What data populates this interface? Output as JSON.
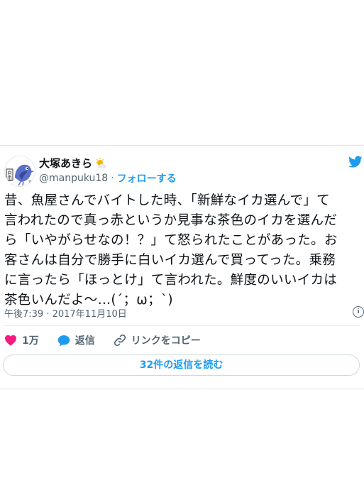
{
  "author": {
    "name": "大塚あきら",
    "name_emoji_icon": "sun-behind-cloud-icon",
    "handle": "@manpuku18",
    "separator": "·",
    "follow_label": "フォローする",
    "avatar_icon": "bird-stamp-avatar"
  },
  "platform_icon": "twitter-bird-icon",
  "tweet": {
    "lines": [
      "昔、魚屋さんでバイトした時、「新鮮なイカ選んで」て",
      "言われたので真っ赤というか見事な茶色のイカを選んだ",
      "ら「いやがらせなの！？」て怒られたことがあった。お",
      "客さんは自分で勝手に白いイカ選んで買ってった。乗務",
      "に言ったら「ほっとけ」て言われた。鮮度のいいイカは",
      "茶色いんだよ〜…(´；ω；`)"
    ],
    "timestamp": "午後7:39 · 2017年11月10日"
  },
  "actions": {
    "like_count": "1万",
    "reply_label": "返信",
    "copy_link_label": "リンクをコピー"
  },
  "replies_button": "32件の返信を読む",
  "colors": {
    "accent": "#1d9bf0",
    "like": "#f91880",
    "text": "#0f1419",
    "muted": "#536471"
  }
}
